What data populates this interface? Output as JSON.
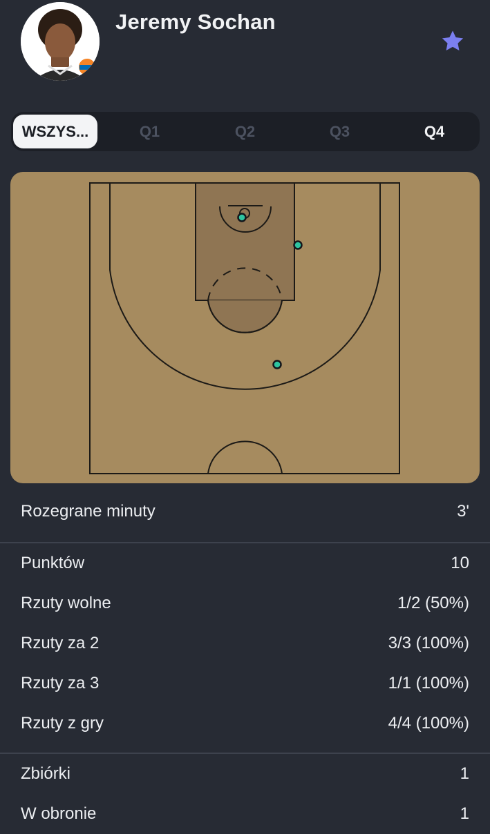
{
  "player": {
    "name": "Jeremy Sochan"
  },
  "tabs": [
    "WSZYS...",
    "Q1",
    "Q2",
    "Q3",
    "Q4"
  ],
  "court": {
    "shots": [
      {
        "made": true,
        "color": "#2ec4a0"
      },
      {
        "made": true,
        "color": "#2ec4a0"
      },
      {
        "made": true,
        "color": "#2ec4a0"
      }
    ]
  },
  "stats": {
    "group1": [
      {
        "label": "Rozegrane minuty",
        "value": "3'"
      }
    ],
    "group2": [
      {
        "label": "Punktów",
        "value": "10"
      },
      {
        "label": "Rzuty wolne",
        "value": "1/2 (50%)"
      },
      {
        "label": "Rzuty za 2",
        "value": "3/3 (100%)"
      },
      {
        "label": "Rzuty za 3",
        "value": "1/1 (100%)"
      },
      {
        "label": "Rzuty z gry",
        "value": "4/4 (100%)"
      }
    ],
    "group3": [
      {
        "label": "Zbiórki",
        "value": "1"
      },
      {
        "label": "W obronie",
        "value": "1"
      }
    ]
  },
  "colors": {
    "background": "#272b34",
    "court": "#a68b5f",
    "paint": "#8f7553",
    "accent_star": "#7b7ff0"
  }
}
